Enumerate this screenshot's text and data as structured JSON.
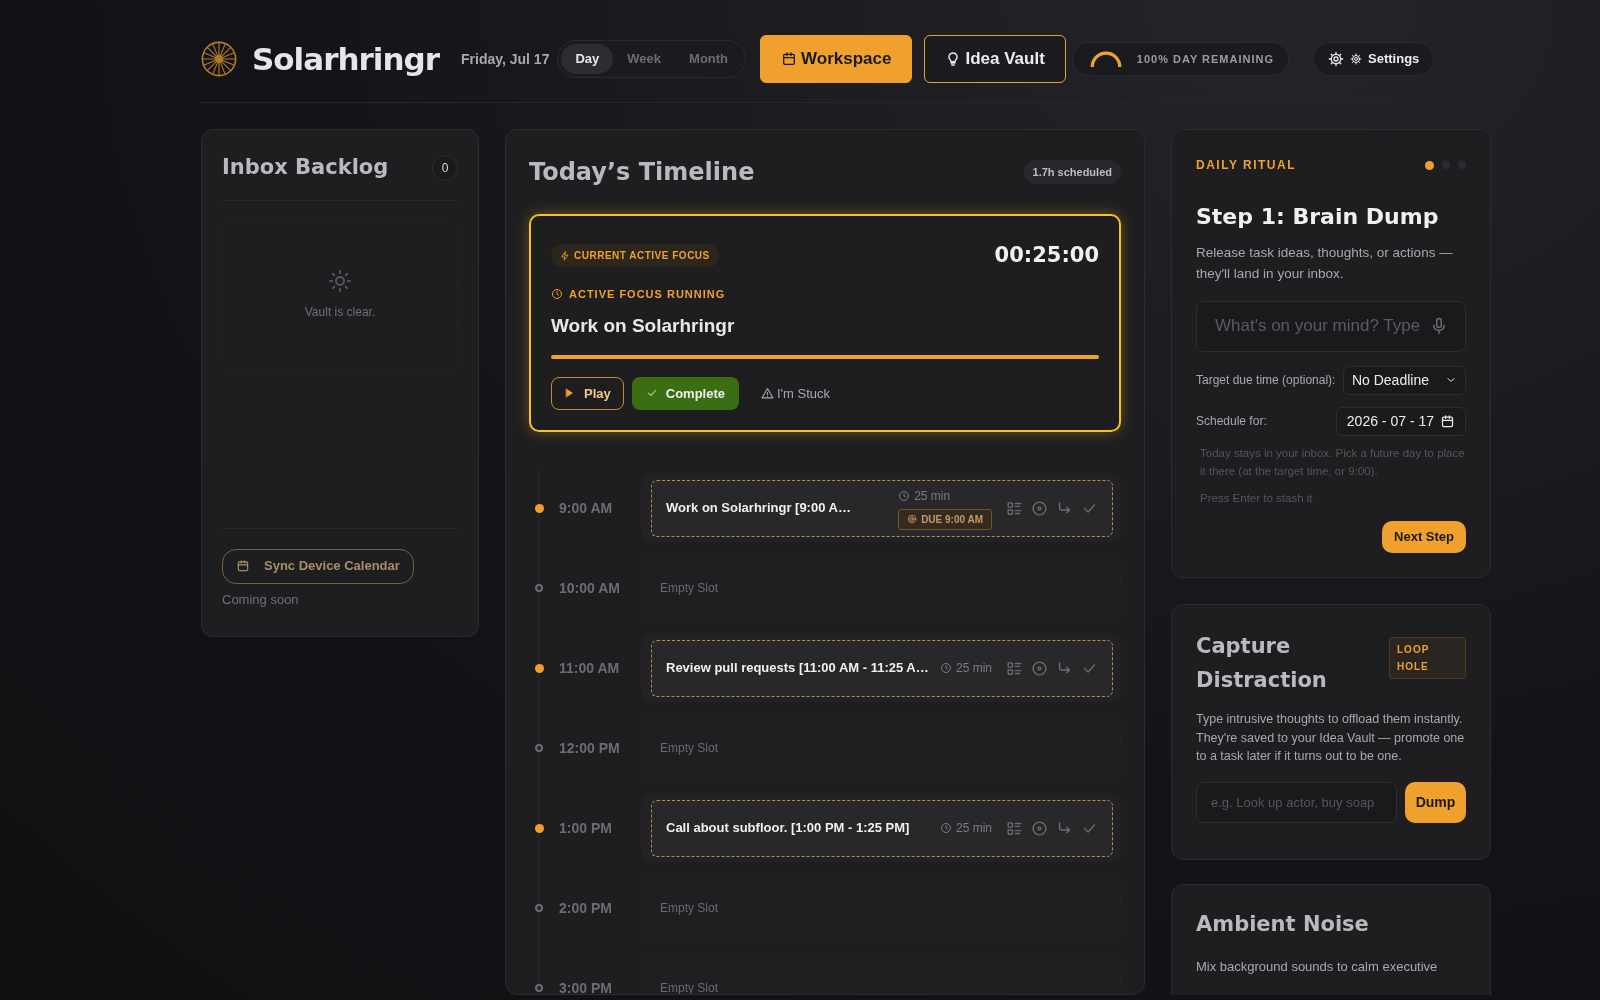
{
  "header": {
    "brand": "Solarhringr",
    "date": "Friday, Jul 17",
    "views": [
      {
        "label": "Day",
        "selected": true
      },
      {
        "label": "Week",
        "selected": false
      },
      {
        "label": "Month",
        "selected": false
      }
    ],
    "workspace_button": {
      "label": "Workspace",
      "selected": true
    },
    "vault_button": {
      "label": "Idea Vault",
      "selected": false
    },
    "day_meter": {
      "level": 1,
      "label": "100% DAY REMAINING"
    },
    "settings_button": "Settings"
  },
  "inbox": {
    "title": "Inbox Backlog",
    "count": "0",
    "empty_text": "Vault is clear.",
    "sync_button": "Sync Device Calendar",
    "note": "Coming soon"
  },
  "timeline": {
    "title": "Today’s Timeline",
    "scheduled": "1.7h scheduled",
    "focus": {
      "badge": "CURRENT ACTIVE FOCUS",
      "timer": "00:25:00",
      "status": "ACTIVE FOCUS RUNNING",
      "task": "Work on Solarhringr",
      "level": 1,
      "play": "Play",
      "complete": "Complete",
      "stuck": "I'm Stuck"
    },
    "slots": [
      {
        "time": "9:00 AM",
        "kind": "task",
        "title": "Work on Solarhringr [9:00 A…",
        "duration": "25 min",
        "due": "DUE 9:00 AM"
      },
      {
        "time": "10:00 AM",
        "kind": "empty",
        "title": "Empty Slot"
      },
      {
        "time": "11:00 AM",
        "kind": "task",
        "title": "Review pull requests [11:00 AM - 11:25 A…",
        "duration": "25 min"
      },
      {
        "time": "12:00 PM",
        "kind": "empty",
        "title": "Empty Slot"
      },
      {
        "time": "1:00 PM",
        "kind": "task",
        "title": "Call about subfloor. [1:00 PM - 1:25 PM]",
        "duration": "25 min"
      },
      {
        "time": "2:00 PM",
        "kind": "empty",
        "title": "Empty Slot"
      },
      {
        "time": "3:00 PM",
        "kind": "empty",
        "title": "Empty Slot"
      }
    ]
  },
  "ritual": {
    "label": "DAILY RITUAL",
    "steps": [
      {
        "selected": true
      },
      {
        "selected": false
      },
      {
        "selected": false
      }
    ],
    "title": "Step 1: Brain Dump",
    "description": "Release task ideas, thoughts, or actions — they'll land in your inbox.",
    "placeholder": "What's on your mind? Type",
    "due_label": "Target due time (optional):",
    "due_value": "No Deadline",
    "schedule_label": "Schedule for:",
    "schedule_value": "2026 - 07 - 17",
    "hint": "Today stays in your inbox. Pick a future day to place it there (at the target time, or 9:00).",
    "enter_hint": "Press Enter to stash it",
    "next_button": "Next Step"
  },
  "capture": {
    "title": "Capture Distraction",
    "tag": "LOOP HOLE",
    "description": "Type intrusive thoughts to offload them instantly. They're saved to your Idea Vault — promote one to a task later if it turns out to be one.",
    "placeholder": "e.g. Look up actor, buy soap",
    "button": "Dump"
  },
  "ambient": {
    "title": "Ambient Noise",
    "description": "Mix background sounds to calm executive"
  }
}
